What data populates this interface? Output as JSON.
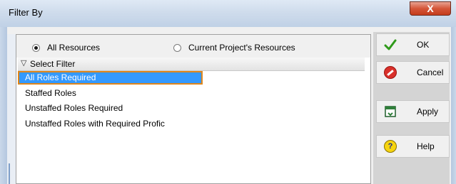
{
  "window": {
    "title": "Filter By",
    "close_glyph": "X"
  },
  "scope": {
    "options": [
      {
        "label": "All Resources",
        "selected": true
      },
      {
        "label": "Current Project's Resources",
        "selected": false
      }
    ]
  },
  "filter": {
    "header_label": "Select Filter",
    "items": [
      {
        "label": "All Roles Required",
        "selected": true
      },
      {
        "label": "Staffed Roles",
        "selected": false
      },
      {
        "label": "Unstaffed Roles Required",
        "selected": false
      },
      {
        "label": "Unstaffed Roles with Required Profic",
        "selected": false
      }
    ]
  },
  "buttons": {
    "ok": "OK",
    "cancel": "Cancel",
    "apply": "Apply",
    "help": "Help"
  },
  "icons": {
    "ok": "checkmark-icon",
    "cancel": "cancel-icon",
    "apply": "apply-icon",
    "help": "help-icon",
    "header": "chevron-down-icon"
  },
  "colors": {
    "selection": "#3399ff",
    "focus_border": "#e0861a",
    "ok_check": "#2f9a1a",
    "cancel_red": "#d9302b",
    "help_yellow": "#f6d40f"
  }
}
